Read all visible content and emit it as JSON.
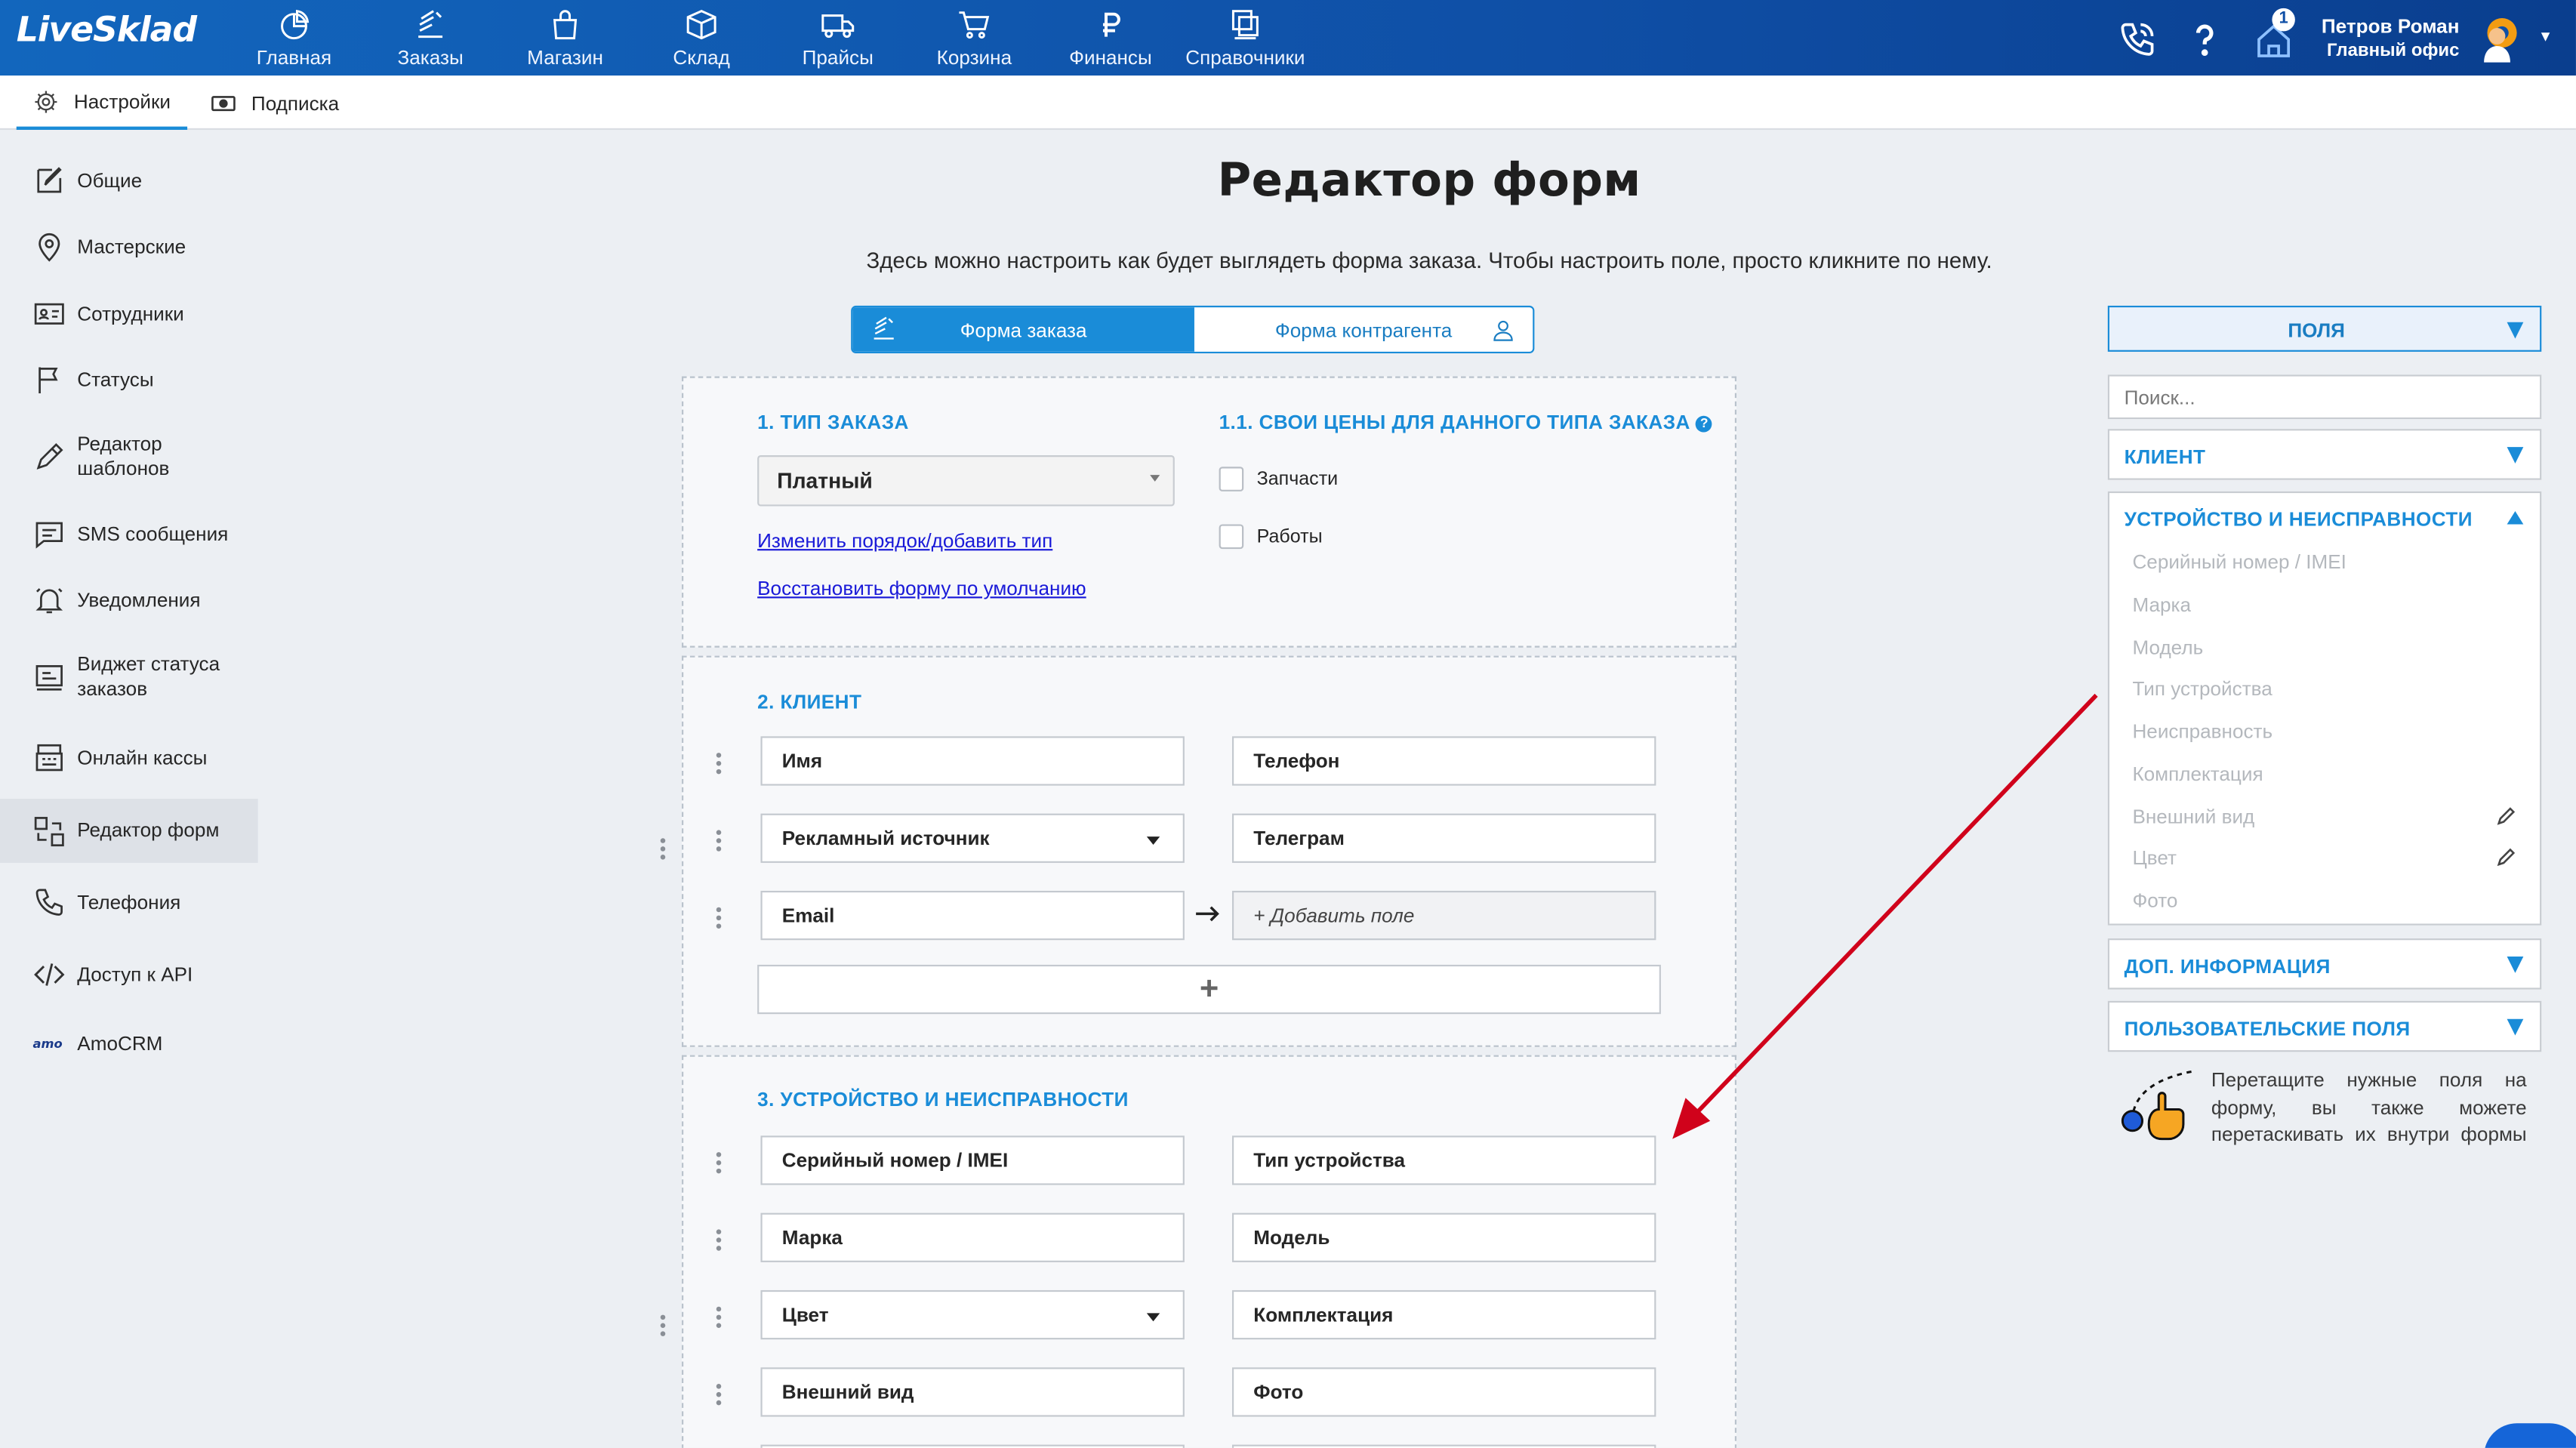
{
  "app": {
    "logo": "LiveSklad"
  },
  "nav": [
    {
      "label": "Главная",
      "icon": "pie-chart-icon"
    },
    {
      "label": "Заказы",
      "icon": "orders-icon"
    },
    {
      "label": "Магазин",
      "icon": "shopping-bag-icon"
    },
    {
      "label": "Склад",
      "icon": "box-icon"
    },
    {
      "label": "Прайсы",
      "icon": "truck-icon"
    },
    {
      "label": "Корзина",
      "icon": "cart-icon"
    },
    {
      "label": "Финансы",
      "icon": "ruble-icon"
    },
    {
      "label": "Справочники",
      "icon": "books-icon"
    }
  ],
  "header": {
    "notification_count": "1",
    "user_name": "Петров Роман",
    "user_office": "Главный офис"
  },
  "subtabs": [
    {
      "label": "Настройки",
      "icon": "gear-icon"
    },
    {
      "label": "Подписка",
      "icon": "banknote-icon"
    }
  ],
  "sidebar": {
    "items": [
      {
        "label": "Общие"
      },
      {
        "label": "Мастерские"
      },
      {
        "label": "Сотрудники"
      },
      {
        "label": "Статусы"
      },
      {
        "label": "Редактор\nшаблонов"
      },
      {
        "label": "SMS сообщения"
      },
      {
        "label": "Уведомления"
      },
      {
        "label": "Виджет статуса\nзаказов"
      },
      {
        "label": "Онлайн кассы"
      },
      {
        "label": "Редактор форм"
      },
      {
        "label": "Телефония"
      },
      {
        "label": "Доступ к API"
      },
      {
        "label": "AmoCRM"
      }
    ]
  },
  "main": {
    "title": "Редактор форм",
    "description": "Здесь можно настроить как будет выглядеть форма заказа. Чтобы настроить поле, просто кликните по нему.",
    "tabs": {
      "order": "Форма заказа",
      "contractor": "Форма контрагента"
    },
    "section1": {
      "title": "1. ТИП ЗАКАЗА",
      "select_value": "Платный",
      "link_reorder": "Изменить порядок/добавить тип",
      "link_restore": "Восстановить форму по умолчанию",
      "prices_title": "1.1. СВОИ ЦЕНЫ ДЛЯ ДАННОГО ТИПА ЗАКАЗА",
      "check_parts": "Запчасти",
      "check_works": "Работы"
    },
    "section2": {
      "title": "2. КЛИЕНТ",
      "fields": [
        "Имя",
        "Телефон",
        "Рекламный источник",
        "Телеграм",
        "Email"
      ],
      "add_field": "+ Добавить поле",
      "plus": "+"
    },
    "section3": {
      "title": "3. УСТРОЙСТВО И НЕИСПРАВНОСТИ",
      "fields": [
        "Серийный номер / IMEI",
        "Тип устройства",
        "Марка",
        "Модель",
        "Цвет",
        "Комплектация",
        "Внешний вид",
        "Фото"
      ]
    }
  },
  "right_panel": {
    "fields_header": "ПОЛЯ",
    "search_placeholder": "Поиск...",
    "client": "КЛИЕНТ",
    "device": "УСТРОЙСТВО И НЕИСПРАВНОСТИ",
    "device_items": [
      "Серийный номер / IMEI",
      "Марка",
      "Модель",
      "Тип устройства",
      "Неисправность",
      "Комплектация",
      "Внешний вид",
      "Цвет",
      "Фото"
    ],
    "extra": "ДОП. ИНФОРМАЦИЯ",
    "custom": "ПОЛЬЗОВАТЕЛЬСКИЕ ПОЛЯ",
    "hint": "Перетащите нужные поля на форму, вы также можете перетаскивать их внутри формы"
  },
  "colors": {
    "accent": "#1a8cd8",
    "header": "#0f4fa6",
    "arrow": "#d0021b"
  }
}
